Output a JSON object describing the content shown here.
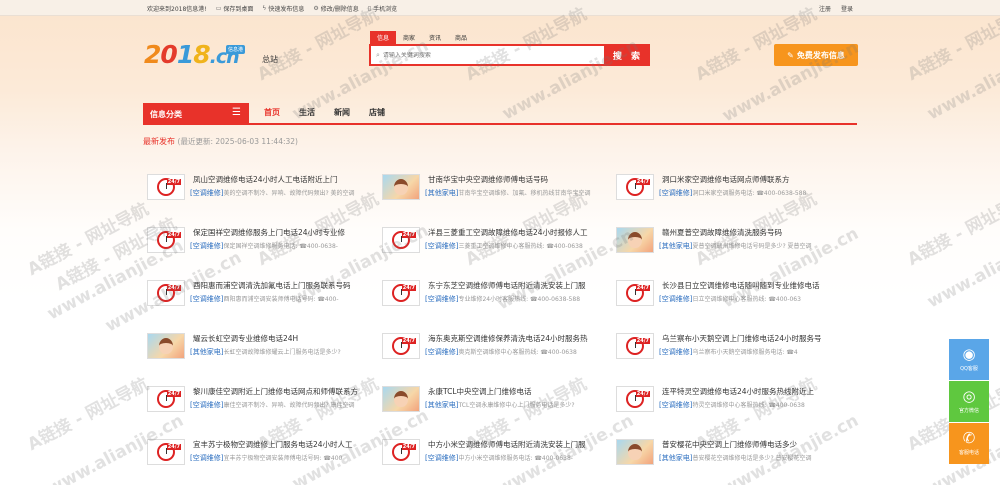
{
  "topbar": {
    "welcome": "欢迎来到2018信息港!",
    "links": [
      {
        "icon": "monitor-icon",
        "label": "保存到桌面"
      },
      {
        "icon": "lightning-icon",
        "label": "快速发布信息"
      },
      {
        "icon": "gear-icon",
        "label": "修改/删除信息"
      },
      {
        "icon": "phone-icon",
        "label": "手机浏览"
      }
    ],
    "register": "注册",
    "login": "登录"
  },
  "logo": {
    "text_2": "2",
    "text_0": "0",
    "text_1": "1",
    "text_8": "8",
    "text_cn": ".cn",
    "badge": "信息港"
  },
  "city": "总站",
  "search": {
    "tabs": [
      "信息",
      "商家",
      "资讯",
      "商品"
    ],
    "active_tab": 0,
    "placeholder": "请输入关键词搜索",
    "button": "搜 索"
  },
  "publish_button": "免费发布信息",
  "nav": {
    "category_label": "信息分类",
    "tabs": [
      "首页",
      "生活",
      "新闻",
      "店铺"
    ]
  },
  "latest": {
    "label": "最新发布",
    "updated": "(最近更新: 2025-06-03 11:44:32)"
  },
  "listings": [
    {
      "thumb": "247",
      "title": "凤山空调维修电话24小时人工电话附近上门",
      "tag": "[空调维修]",
      "desc": "美的空调不制冷、异响、故障代码频出? 美的空调"
    },
    {
      "thumb": "girl",
      "title": "甘南华宝中央空调维修师傅电话号码",
      "tag": "[其他家电]",
      "desc": "甘南华宝空调维修、加氟、移机热线甘南华宝空调"
    },
    {
      "thumb": "247",
      "title": "洞口米家空调维修电话网点师傅联系方",
      "tag": "[空调维修]",
      "desc": "洞口米家空调服务电话: ☎400-0638-588"
    },
    {
      "thumb": "247",
      "title": "保定国祥空调维修服务上门电话24小时专业修",
      "tag": "[空调维修]",
      "desc": "保定国祥空调维修服务电话: ☎400-0638-"
    },
    {
      "thumb": "247",
      "title": "洋县三菱重工空调故障维修电话24小时报修人工",
      "tag": "[空调维修]",
      "desc": "三菱重工空调维修中心客服热线: ☎400-0638"
    },
    {
      "thumb": "girl",
      "title": "赣州夏普空调故障维修清洗服务号码",
      "tag": "[其他家电]",
      "desc": "夏普空调赣州维修电话号码是多少? 夏普空调"
    },
    {
      "thumb": "247",
      "title": "酉阳惠而浦空调清洗加氟电话上门服务联系号码",
      "tag": "[空调维修]",
      "desc": "酉阳惠而浦空调安装师傅电话号码: ☎400-"
    },
    {
      "thumb": "247",
      "title": "东宁东芝空调维修师傅电话附近清洗安装上门服",
      "tag": "[空调维修]",
      "desc": "专业维修24小时客服热线: ☎400-0638-588"
    },
    {
      "thumb": "247",
      "title": "长沙县日立空调维修电话随叫随到专业维修电话",
      "tag": "[空调维修]",
      "desc": "日立空调维修中心客服热线: ☎400-063"
    },
    {
      "thumb": "girl",
      "title": "耀云长虹空调专业维修电话24H",
      "tag": "[其他家电]",
      "desc": "长虹空调故障维修耀云上门服务电话是多少?"
    },
    {
      "thumb": "247",
      "title": "海东奥克斯空调维修保养清洗电话24小时服务热",
      "tag": "[空调维修]",
      "desc": "奥克斯空调维修中心客服热线: ☎400-0638"
    },
    {
      "thumb": "247",
      "title": "乌兰察布小天鹅空调上门维修电话24小时服务号",
      "tag": "[空调维修]",
      "desc": "乌兰察布小天鹅空调维修服务电话: ☎4"
    },
    {
      "thumb": "247",
      "title": "黎川康佳空调附近上门维修电话网点和师傅联系方",
      "tag": "[空调维修]",
      "desc": "康佳空调不制冷、异响、故障代码频出? 康佳空调"
    },
    {
      "thumb": "girl",
      "title": "永康TCL中央空调上门维修电话",
      "tag": "[其他家电]",
      "desc": "TCL空调永康维修中心上门服务电话是多少?"
    },
    {
      "thumb": "247",
      "title": "连平特灵空调维修电话24小时服务热线附近上",
      "tag": "[空调维修]",
      "desc": "特灵空调维修中心客服热线: ☎400-0638"
    },
    {
      "thumb": "247",
      "title": "宜丰苏宁极物空调维修上门服务电话24小时人工",
      "tag": "[空调维修]",
      "desc": "宜丰苏宁极物空调安装师傅电话号码: ☎400"
    },
    {
      "thumb": "247",
      "title": "中方小米空调维修师傅电话附近清洗安装上门服",
      "tag": "[空调维修]",
      "desc": "中方小米空调维修服务电话: ☎400-0638-"
    },
    {
      "thumb": "girl",
      "title": "普安樱花中央空调上门维修师傅电话多少",
      "tag": "[其他家电]",
      "desc": "普安樱花空调维修电话是多少? 普安樱花空调"
    }
  ],
  "watermark": {
    "cn": "A链接 - 网址导航",
    "url": "www.alianjie.cn"
  },
  "sidebar": [
    {
      "icon": "qq-icon",
      "label": "QQ客服"
    },
    {
      "icon": "wechat-icon",
      "label": "官方微信"
    },
    {
      "icon": "phone-icon",
      "label": "客服电话"
    }
  ]
}
